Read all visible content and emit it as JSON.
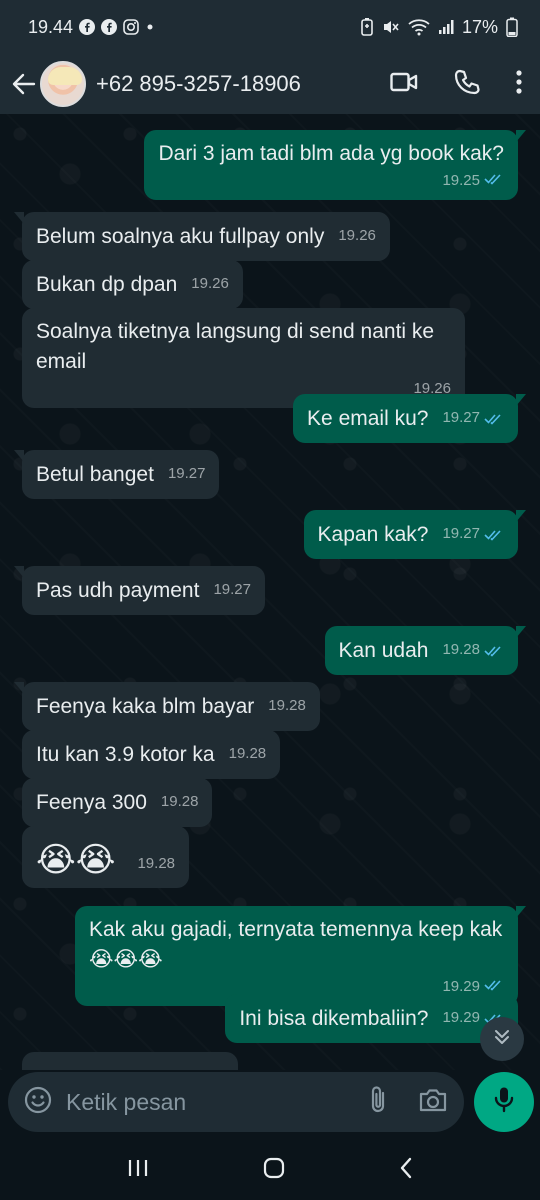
{
  "status_bar": {
    "time": "19.44",
    "battery": "17%"
  },
  "header": {
    "contact": "+62 895-3257-18906"
  },
  "messages": [
    {
      "dir": "out",
      "text": "Dari 3 jam tadi blm ada yg book kak?",
      "time": "19.25"
    },
    {
      "dir": "in",
      "text": "Belum soalnya aku fullpay only",
      "time": "19.26"
    },
    {
      "dir": "in",
      "text": "Bukan dp dpan",
      "time": "19.26"
    },
    {
      "dir": "in",
      "text": "Soalnya tiketnya langsung di send nanti ke email",
      "time": "19.26"
    },
    {
      "dir": "out",
      "text": "Ke email ku?",
      "time": "19.27"
    },
    {
      "dir": "in",
      "text": "Betul banget",
      "time": "19.27"
    },
    {
      "dir": "out",
      "text": "Kapan kak?",
      "time": "19.27"
    },
    {
      "dir": "in",
      "text": "Pas udh payment",
      "time": "19.27"
    },
    {
      "dir": "out",
      "text": "Kan udah",
      "time": "19.28"
    },
    {
      "dir": "in",
      "text": "Feenya kaka blm bayar",
      "time": "19.28"
    },
    {
      "dir": "in",
      "text": "Itu kan 3.9 kotor ka",
      "time": "19.28"
    },
    {
      "dir": "in",
      "text": "Feenya 300",
      "time": "19.28"
    },
    {
      "dir": "in",
      "text": "😭😭",
      "time": "19.28"
    },
    {
      "dir": "out",
      "text": "Kak aku gajadi, ternyata temennya keep kak😭😭😭",
      "time": "19.29"
    },
    {
      "dir": "out",
      "text": "Ini bisa dikembaliin?",
      "time": "19.29"
    }
  ],
  "composer": {
    "placeholder": "Ketik pesan"
  },
  "colors": {
    "incoming": "#202c33",
    "outgoing": "#005c4b",
    "accent": "#00a884",
    "tick": "#53bdeb"
  },
  "icons": [
    "back-arrow-icon",
    "video-call-icon",
    "voice-call-icon",
    "more-icon",
    "emoji-icon",
    "attach-icon",
    "camera-icon",
    "mic-icon",
    "chevron-double-down-icon"
  ]
}
